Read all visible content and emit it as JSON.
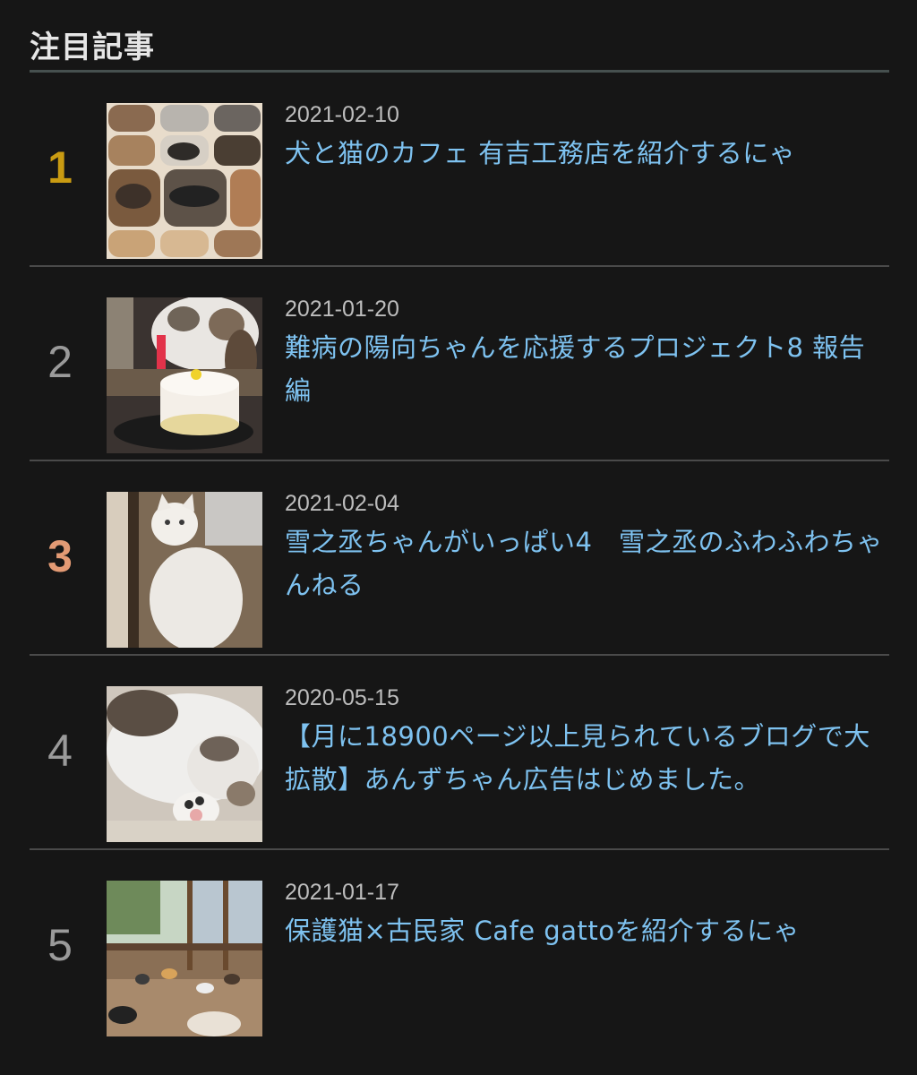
{
  "widget": {
    "heading": "注目記事"
  },
  "articles": [
    {
      "rank": "1",
      "date": "2021-02-10",
      "title": "犬と猫のカフェ 有吉工務店を紹介するにゃ"
    },
    {
      "rank": "2",
      "date": "2021-01-20",
      "title": "難病の陽向ちゃんを応援するプロジェクト8 報告編"
    },
    {
      "rank": "3",
      "date": "2021-02-04",
      "title": "雪之丞ちゃんがいっぱい4　雪之丞のふわふわちゃんねる"
    },
    {
      "rank": "4",
      "date": "2020-05-15",
      "title": "【月に18900ページ以上見られているブログで大拡散】あんずちゃん広告はじめました。"
    },
    {
      "rank": "5",
      "date": "2021-01-17",
      "title": "保護猫×古民家 Cafe gattoを紹介するにゃ"
    }
  ],
  "colors": {
    "background": "#161616",
    "link": "#7ec2f0",
    "rank_gold": "#c99b12",
    "rank_bronze": "#e39a74",
    "rank_default": "#9a9a9a"
  }
}
